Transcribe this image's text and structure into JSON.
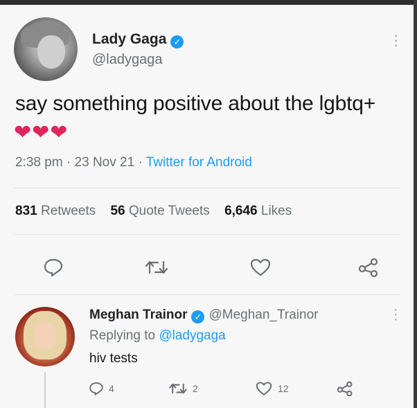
{
  "tweet": {
    "author_name": "Lady Gaga",
    "author_handle": "@ladygaga",
    "text": "say something positive about the lgbtq+",
    "emoji": "❤❤❤",
    "time": "2:38 pm",
    "date": "23 Nov 21",
    "source": "Twitter for Android",
    "stats": {
      "retweets_count": "831",
      "retweets_label": "Retweets",
      "quotes_count": "56",
      "quotes_label": "Quote Tweets",
      "likes_count": "6,646",
      "likes_label": "Likes"
    }
  },
  "reply": {
    "author_name": "Meghan Trainor",
    "author_handle": "@Meghan_Trainor",
    "replying_label": "Replying to",
    "replying_handle": "@ladygaga",
    "text": "hiv tests",
    "replies_count": "4",
    "retweets_count": "2",
    "likes_count": "12"
  },
  "colors": {
    "accent": "#1d9bf0",
    "heart": "#e0245e",
    "muted": "#6b6f73"
  }
}
